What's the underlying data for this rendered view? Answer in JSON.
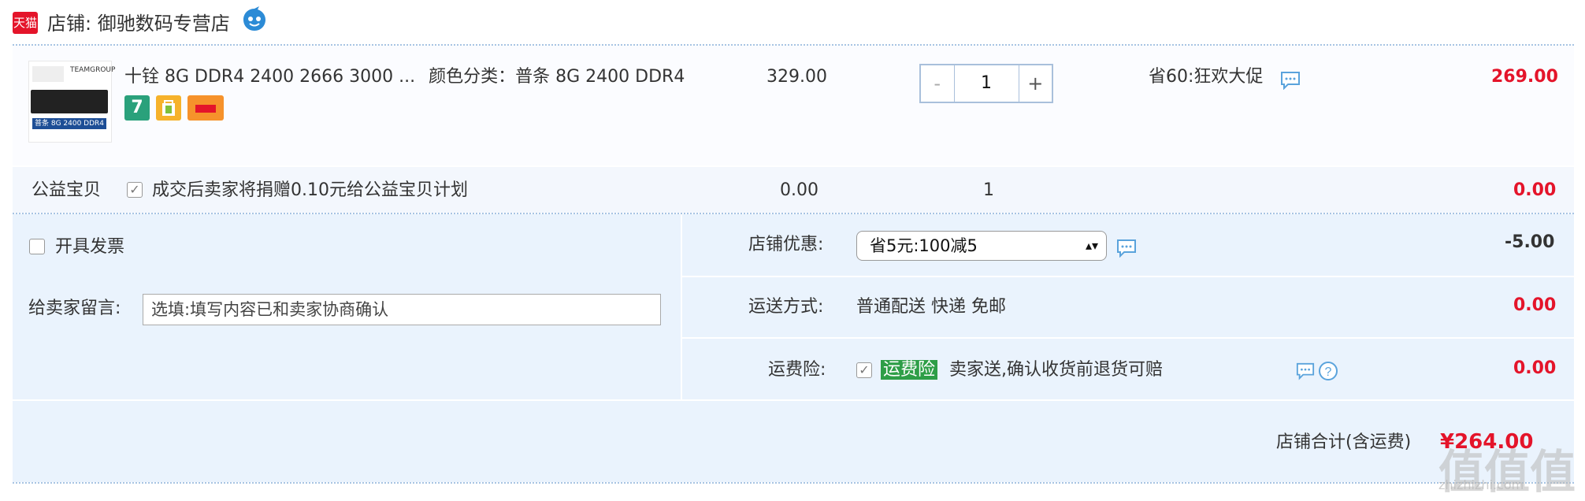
{
  "store": {
    "badge": "天猫",
    "label": "店铺:",
    "name": "御驰数码专营店"
  },
  "item": {
    "thumb_text": "普条 8G 2400 DDR4",
    "thumb_brand": "TEAMGROUP",
    "title": "十铨 8G DDR4 2400 2666 3000 ...",
    "option_label": "颜色分类：",
    "option_value": "普条 8G 2400 DDR4",
    "price": "329.00",
    "qty_minus": "-",
    "qty": "1",
    "qty_plus": "+",
    "promo": "省60:狂欢大促",
    "subtotal": "269.00",
    "badge7": "7"
  },
  "charity": {
    "label": "公益宝贝",
    "desc": "成交后卖家将捐赠0.10元给公益宝贝计划",
    "price": "0.00",
    "qty": "1",
    "subtotal": "0.00"
  },
  "invoice": {
    "label": "开具发票"
  },
  "store_discount": {
    "label": "店铺优惠:",
    "selected": "省5元:100减5",
    "value": "-5.00"
  },
  "message": {
    "label": "给卖家留言:",
    "placeholder": "选填:填写内容已和卖家协商确认"
  },
  "shipping": {
    "label": "运送方式:",
    "value": "普通配送 快递 免邮",
    "cost": "0.00"
  },
  "insurance": {
    "label": "运费险:",
    "tag": "运费险",
    "desc": "卖家送,确认收货前退货可赔",
    "cost": "0.00"
  },
  "total": {
    "label": "店铺合计(含运费)",
    "value": "¥264.00"
  },
  "watermark": {
    "text": "值值值",
    "url": "zhizhizhi.com"
  },
  "colors": {
    "accent": "#e4142a",
    "brand": "#e4142a",
    "insurance": "#2e9e47",
    "link": "#2c8bd6"
  }
}
